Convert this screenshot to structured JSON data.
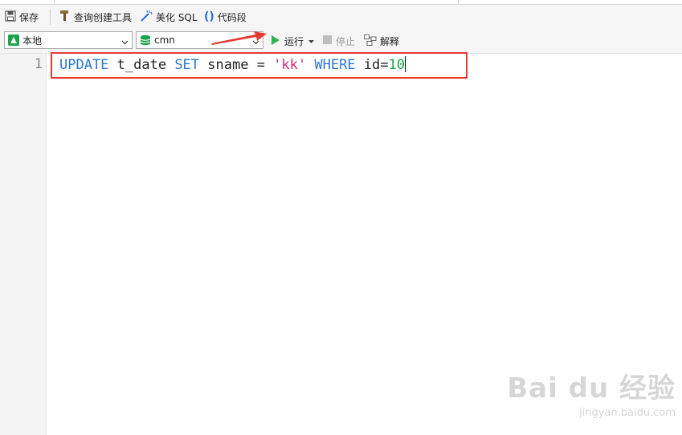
{
  "toolbar": {
    "save_label": "保存",
    "query_builder_label": "查询创建工具",
    "beautify_label": "美化 SQL",
    "snippet_label": "代码段"
  },
  "connection": {
    "selected": "本地"
  },
  "database": {
    "selected": "cmn"
  },
  "actions": {
    "run_label": "运行",
    "stop_label": "停止",
    "explain_label": "解释"
  },
  "editor": {
    "line_number": "1",
    "tokens": {
      "t1": "UPDATE",
      "t2": " t_date ",
      "t3": "SET",
      "t4": " sname = ",
      "t5": "'kk'",
      "t6": " ",
      "t7": "WHERE",
      "t8": " id=",
      "t9": "10"
    }
  },
  "watermark": {
    "brand": "Bai du 经验",
    "url": "jingyan.baidu.com"
  },
  "colors": {
    "keyword": "#2c76d0",
    "string": "#d6287a",
    "number": "#13a44a",
    "highlight_box": "#e53935"
  }
}
